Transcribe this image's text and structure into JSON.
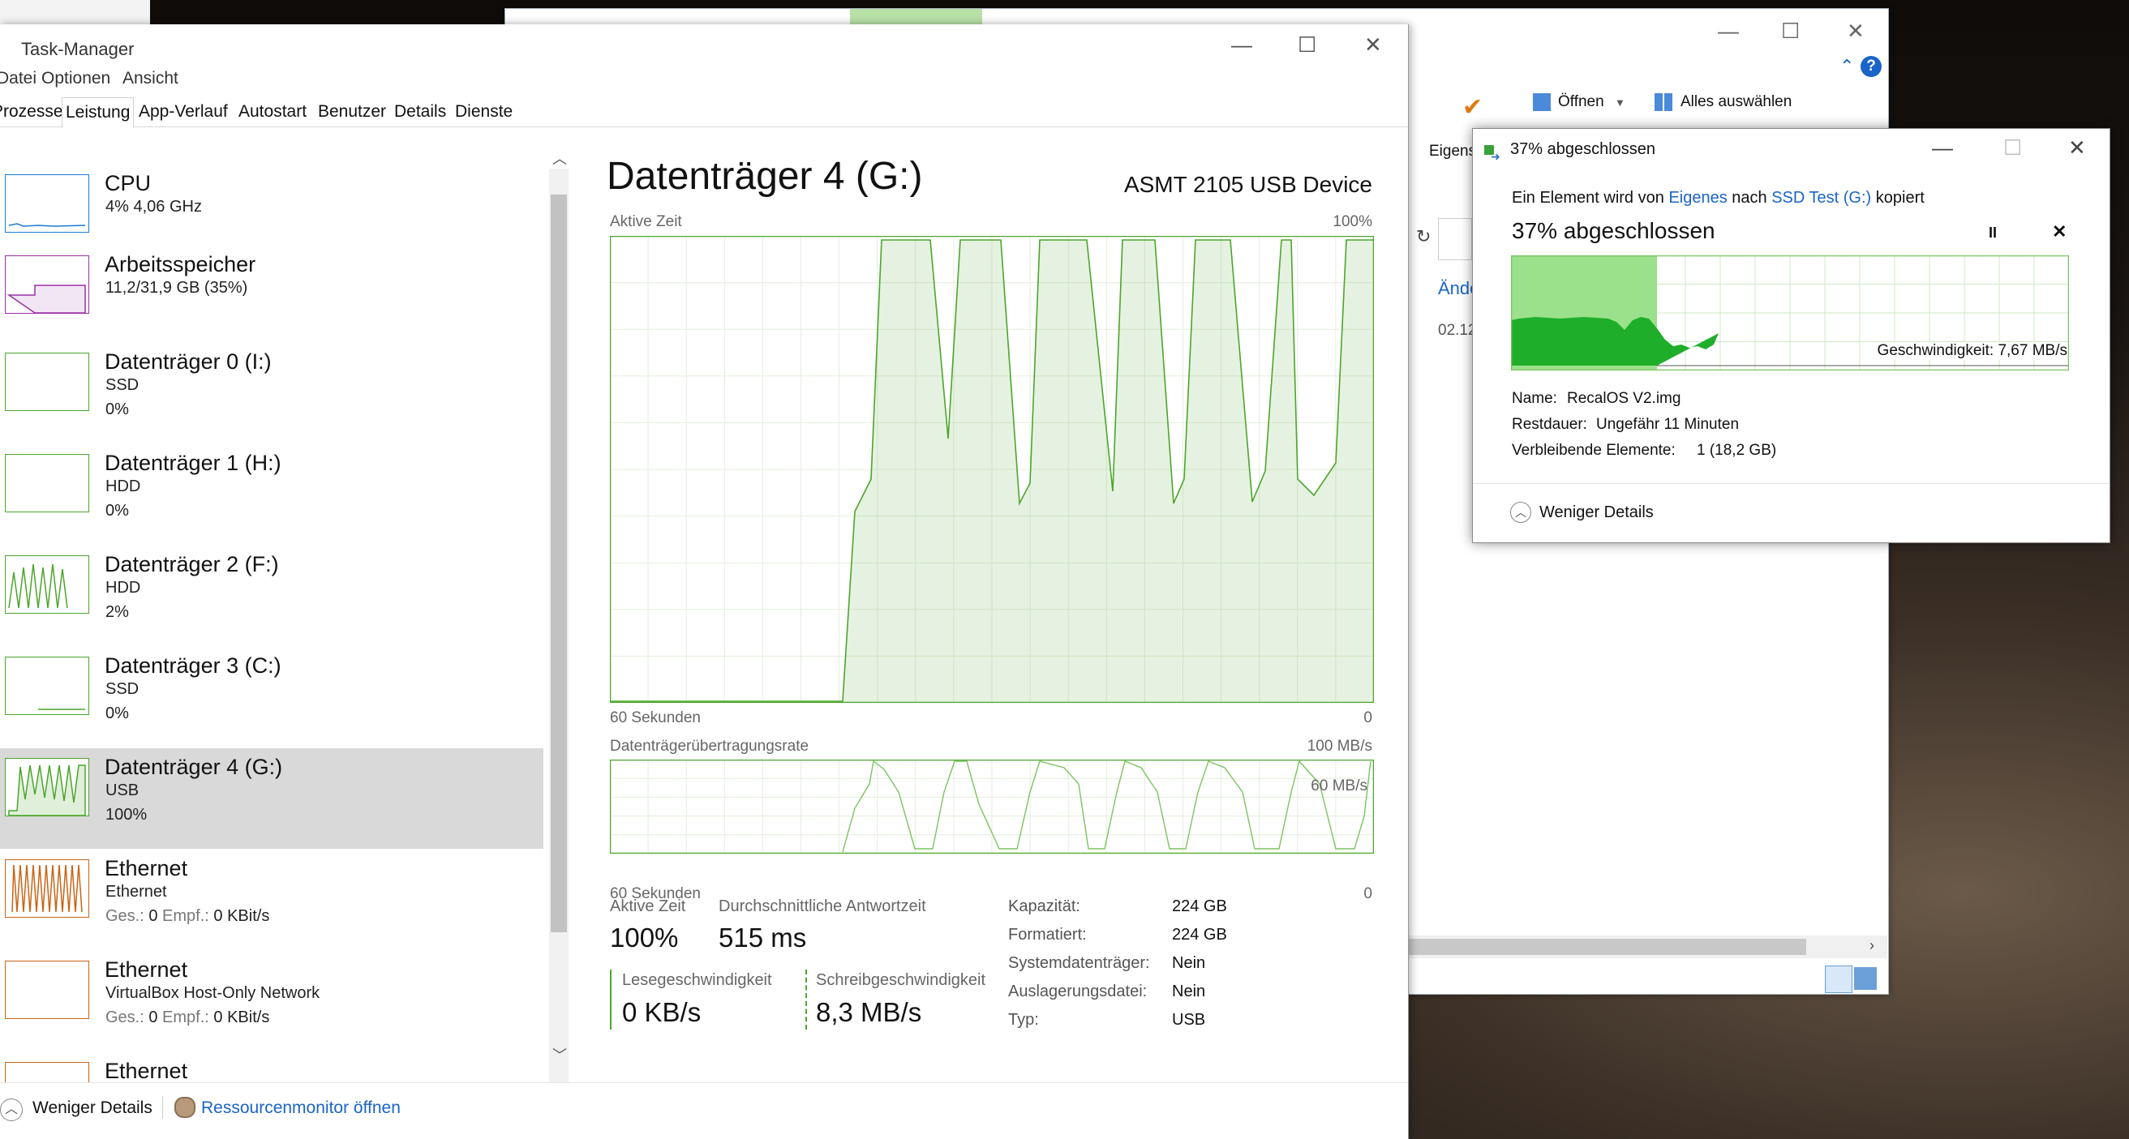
{
  "taskmanager": {
    "title": "Task-Manager",
    "menu": [
      "Datei",
      "Optionen",
      "Ansicht"
    ],
    "tabs": [
      "Prozesse",
      "Leistung",
      "App-Verlauf",
      "Autostart",
      "Benutzer",
      "Details",
      "Dienste"
    ],
    "sidebar": [
      {
        "name": "CPU",
        "line1": "4%  4,06 GHz",
        "color": "#1a7bd6"
      },
      {
        "name": "Arbeitsspeicher",
        "line1": "11,2/31,9 GB (35%)",
        "color": "#9b2ea8"
      },
      {
        "name": "Datenträger 0 (I:)",
        "line1": "SSD",
        "line2": "0%",
        "color": "#4ca52c"
      },
      {
        "name": "Datenträger 1 (H:)",
        "line1": "HDD",
        "line2": "0%",
        "color": "#4ca52c"
      },
      {
        "name": "Datenträger 2 (F:)",
        "line1": "HDD",
        "line2": "2%",
        "color": "#4ca52c"
      },
      {
        "name": "Datenträger 3 (C:)",
        "line1": "SSD",
        "line2": "0%",
        "color": "#4ca52c"
      },
      {
        "name": "Datenträger 4 (G:)",
        "line1": "USB",
        "line2": "100%",
        "color": "#4ca52c"
      },
      {
        "name": "Ethernet",
        "line1": "Ethernet",
        "ges_label": "Ges.:",
        "ges_value": "0",
        "empf_label": "Empf.:",
        "empf_value": "0 KBit/s",
        "color": "#c86414"
      },
      {
        "name": "Ethernet",
        "line1": "VirtualBox Host-Only Network",
        "ges_label": "Ges.:",
        "ges_value": "0",
        "empf_label": "Empf.:",
        "empf_value": "0 KBit/s",
        "color": "#c86414"
      },
      {
        "name": "Ethernet",
        "color": "#c86414"
      }
    ],
    "selected_index": 6,
    "main": {
      "title": "Datenträger 4 (G:)",
      "device": "ASMT 2105 USB Device",
      "graph1_label": "Aktive Zeit",
      "graph1_max": "100%",
      "graph1_bottom_left": "60 Sekunden",
      "graph1_bottom_right": "0",
      "graph2_label": "Datenträgerübertragungsrate",
      "graph2_max": "100 MB/s",
      "graph2_mid": "60 MB/s",
      "graph2_bottom_left": "60 Sekunden",
      "graph2_bottom_right": "0",
      "active_time_label": "Aktive Zeit",
      "active_time_value": "100%",
      "avg_response_label": "Durchschnittliche Antwortzeit",
      "avg_response_value": "515 ms",
      "read_label": "Lesegeschwindigkeit",
      "read_value": "0 KB/s",
      "write_label": "Schreibgeschwindigkeit",
      "write_value": "8,3 MB/s",
      "info": [
        {
          "k": "Kapazität:",
          "v": "224 GB"
        },
        {
          "k": "Formatiert:",
          "v": "224 GB"
        },
        {
          "k": "Systemdatenträger:",
          "v": "Nein"
        },
        {
          "k": "Auslagerungsdatei:",
          "v": "Nein"
        },
        {
          "k": "Typ:",
          "v": "USB"
        }
      ]
    },
    "bottom": {
      "less_details": "Weniger Details",
      "resource_monitor": "Ressourcenmonitor öffnen"
    }
  },
  "explorer": {
    "open": "Öffnen",
    "select_all": "Alles auswählen",
    "eigens": "Eigens",
    "aende": "Ände",
    "date": "02.12"
  },
  "copy_dialog": {
    "title": "37% abgeschlossen",
    "desc_pre": "Ein Element wird von",
    "src": "Eigenes",
    "desc_mid": "nach",
    "dst": "SSD Test (G:)",
    "desc_post": "kopiert",
    "progress_title": "37% abgeschlossen",
    "progress_fraction": 0.37,
    "speed": "Geschwindigkeit: 7,67 MB/s",
    "name_label": "Name:",
    "name_value": "RecalOS V2.img",
    "remaining_label": "Restdauer:",
    "remaining_value": "Ungefähr 11 Minuten",
    "items_label": "Verbleibende Elemente:",
    "items_value": "1 (18,2 GB)",
    "less_details": "Weniger Details"
  }
}
